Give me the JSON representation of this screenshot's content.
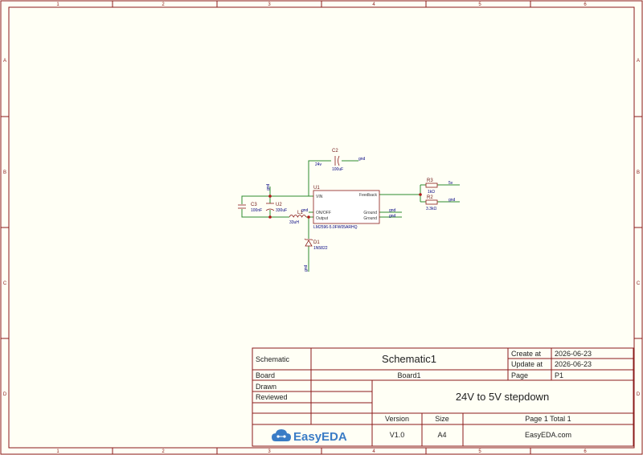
{
  "frame": {
    "columns": [
      "1",
      "2",
      "3",
      "4",
      "5",
      "6"
    ],
    "rows": [
      "A",
      "B",
      "C",
      "D"
    ]
  },
  "title_block": {
    "schematic_label": "Schematic",
    "schematic_value": "Schematic1",
    "create_label": "Create at",
    "create_value": "2026-06-23",
    "update_label": "Update at",
    "update_value": "2026-06-23",
    "board_label": "Board",
    "board_value": "Board1",
    "page_label": "Page",
    "page_value": "P1",
    "drawn_label": "Drawn",
    "reviewed_label": "Reviewed",
    "description": "24V to 5V stepdown",
    "version_label": "Version",
    "version_value": "V1.0",
    "size_label": "Size",
    "size_value": "A4",
    "page_total": "Page  1  Total  1",
    "site": "EasyEDA.com",
    "logo_text": "EasyEDA"
  },
  "components": {
    "u1": {
      "ref": "U1",
      "part": "LM2596-5.0FW05ARHQ",
      "pin_vin": "VIN",
      "pin_onoff": "ON/OFF",
      "pin_output": "Output",
      "pin_feedback": "Feedback",
      "pin_ground1": "Ground",
      "pin_ground2": "Ground"
    },
    "c2": {
      "ref": "C2",
      "value": "100uF"
    },
    "c3": {
      "ref": "C3",
      "value": "100nF"
    },
    "u2": {
      "ref": "U2",
      "value": "330uF"
    },
    "l1": {
      "ref": "L1",
      "value": "33uH"
    },
    "d1": {
      "ref": "D1",
      "value": "1N5822"
    },
    "r3": {
      "ref": "R3",
      "value": "1kΩ"
    },
    "r2": {
      "ref": "R2",
      "value": "3.3kΩ"
    }
  },
  "nets": {
    "gnd_c2": "gnd",
    "in_24v": "24v",
    "gnd_u2": "gnd",
    "gnd_onoff": "gnd",
    "gnd_ground1": "gnd",
    "gnd_ground2": "gnd",
    "out_5v": "5v",
    "gnd_r2": "gnd",
    "gnd_d1": "gnd"
  },
  "colors": {
    "frame": "#8b1a1a",
    "wire": "#2e8b2e",
    "net_label": "#000080",
    "background": "#fffff5",
    "logo": "#3a7cc6"
  }
}
